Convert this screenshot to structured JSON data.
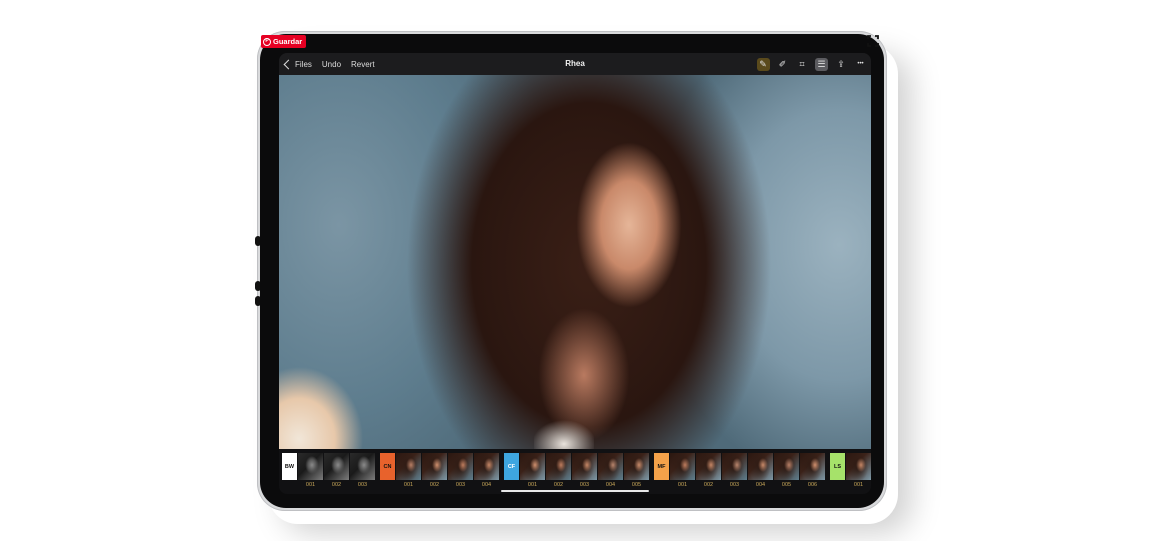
{
  "pinterest": {
    "save_label": "Guardar",
    "icon": "pinterest-icon"
  },
  "toolbar": {
    "back_label": "Files",
    "undo_label": "Undo",
    "revert_label": "Revert",
    "title": "Rhea",
    "tools": [
      {
        "name": "auto-enhance-icon",
        "glyph": "✎",
        "active": true,
        "active_color": "gold"
      },
      {
        "name": "brush-icon",
        "glyph": "✐",
        "active": false
      },
      {
        "name": "crop-icon",
        "glyph": "⌗",
        "active": false
      },
      {
        "name": "adjustments-icon",
        "glyph": "☰",
        "active": true,
        "active_color": "gray"
      },
      {
        "name": "share-icon",
        "glyph": "⇪",
        "active": false
      },
      {
        "name": "more-icon",
        "glyph": "•••",
        "active": false
      }
    ]
  },
  "photo": {
    "description_icon": "portrait-photo"
  },
  "filmstrip": {
    "groups": [
      {
        "tag": "BW",
        "tag_bg": "#ffffff",
        "tag_fg": "#111111",
        "items": [
          "001",
          "002",
          "003"
        ],
        "tone": "bw"
      },
      {
        "tag": "CN",
        "tag_bg": "#e8622c",
        "tag_fg": "#111111",
        "items": [
          "001",
          "002",
          "003",
          "004"
        ],
        "tone": "color"
      },
      {
        "tag": "CF",
        "tag_bg": "#3ea6e0",
        "tag_fg": "#ffffff",
        "items": [
          "001",
          "002",
          "003",
          "004",
          "005"
        ],
        "tone": "color"
      },
      {
        "tag": "MF",
        "tag_bg": "#f4a24a",
        "tag_fg": "#111111",
        "items": [
          "001",
          "002",
          "003",
          "004",
          "005",
          "006"
        ],
        "tone": "color"
      },
      {
        "tag": "LS",
        "tag_bg": "#a6e26a",
        "tag_fg": "#111111",
        "items": [
          "001"
        ],
        "tone": "color"
      }
    ]
  },
  "colors": {
    "accent_gold": "#c9a85a",
    "pinterest_red": "#e60023"
  }
}
